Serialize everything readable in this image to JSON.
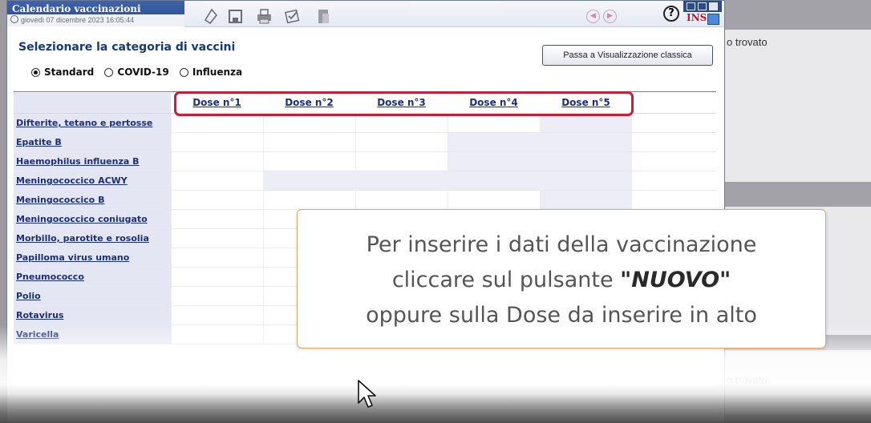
{
  "window": {
    "title": "Calendario vaccinazioni",
    "datetime": "giovedì 07 dicembre 2023  16:05:44",
    "mode_indicator": "INS",
    "help_glyph": "?",
    "nav_prev_glyph": "◀",
    "nav_next_glyph": "▶"
  },
  "background": {
    "right_text_top": "o trovato",
    "right_text_bottom": "o trovato"
  },
  "toolbar_icons": [
    "document-icon",
    "save-icon",
    "print-icon",
    "checklist-icon",
    "file-icon"
  ],
  "category": {
    "heading": "Selezionare la categoria di vaccini",
    "options": [
      {
        "label": "Standard",
        "selected": true
      },
      {
        "label": "COVID-19",
        "selected": false
      },
      {
        "label": "Influenza",
        "selected": false
      }
    ]
  },
  "classic_view_button": "Passa a Visualizzazione classica",
  "table": {
    "doses": [
      "Dose n°1",
      "Dose n°2",
      "Dose n°3",
      "Dose n°4",
      "Dose n°5"
    ],
    "vaccines": [
      "Difterite, tetano e pertosse",
      "Epatite B",
      "Haemophilus influenza B",
      "Meningococcico ACWY",
      "Meningococcico B",
      "Meningococcico coniugato",
      "Morbillo, parotite e rosolia",
      "Papilloma virus umano",
      "Pneumococco",
      "Polio",
      "Rotavirus",
      "Varicella"
    ]
  },
  "callout": {
    "line1": "Per inserire i dati della vaccinazione",
    "line2_pre": "cliccare sul pulsante ",
    "line2_bold": "\"NUOVO\"",
    "line3": "oppure sulla Dose da inserire in alto"
  },
  "colors": {
    "title_bar": "#2b4b8b",
    "heading": "#16387f",
    "highlight_border": "#c4203a",
    "callout_border": "#e7a66a"
  }
}
